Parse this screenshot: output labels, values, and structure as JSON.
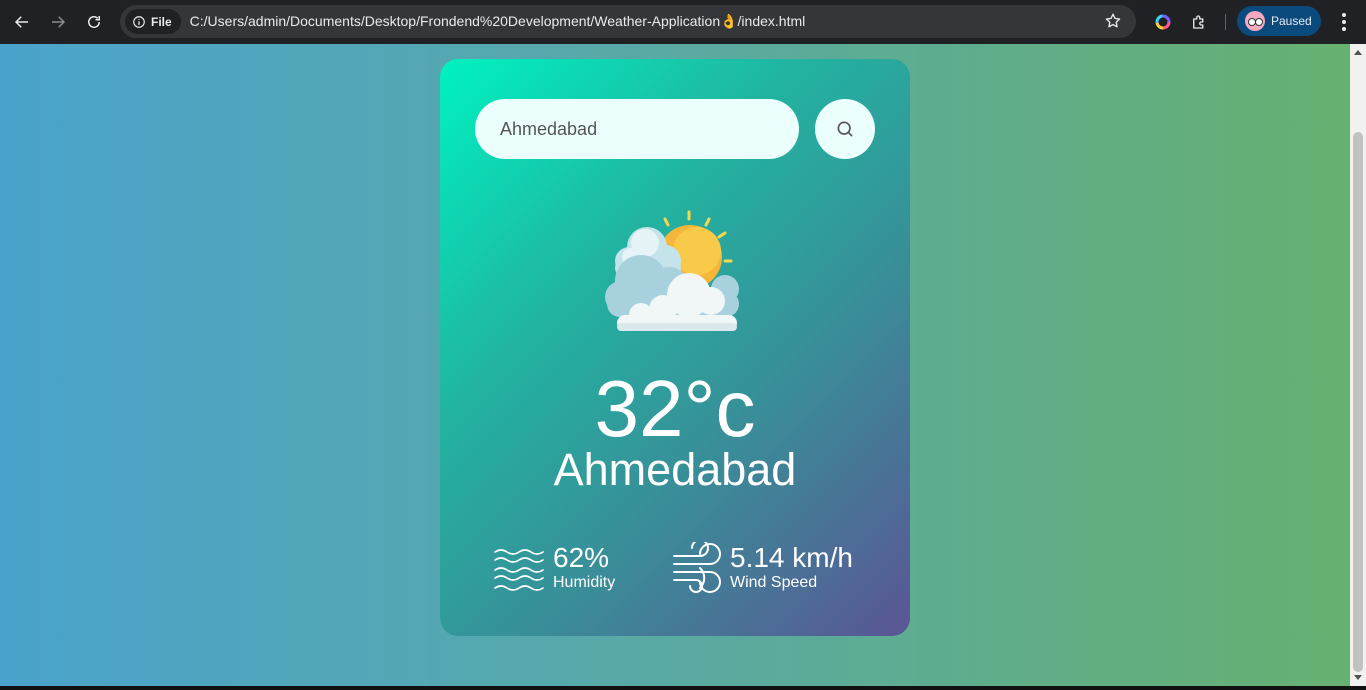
{
  "browser": {
    "url": "C:/Users/admin/Documents/Desktop/Frondend%20Development/Weather-Application👌/index.html",
    "site_chip_label": "File",
    "profile_label": "Paused",
    "icons": [
      "back-arrow-icon",
      "forward-arrow-icon",
      "reload-icon",
      "info-icon",
      "star-icon",
      "color-extension-icon",
      "puzzle-icon",
      "kebab-menu-icon"
    ]
  },
  "weather": {
    "search_value": "Ahmedabad",
    "condition_icon": "partly-cloudy-icon",
    "temperature": "32°c",
    "city": "Ahmedabad",
    "humidity_value": "62%",
    "humidity_label": "Humidity",
    "wind_value": "5.14 km/h",
    "wind_label": "Wind Speed",
    "colors": {
      "card_gradient_start": "#00f2c0",
      "card_gradient_end": "#5b5595",
      "page_gradient_start": "#4aa3cc",
      "page_gradient_end": "#66b070"
    }
  }
}
